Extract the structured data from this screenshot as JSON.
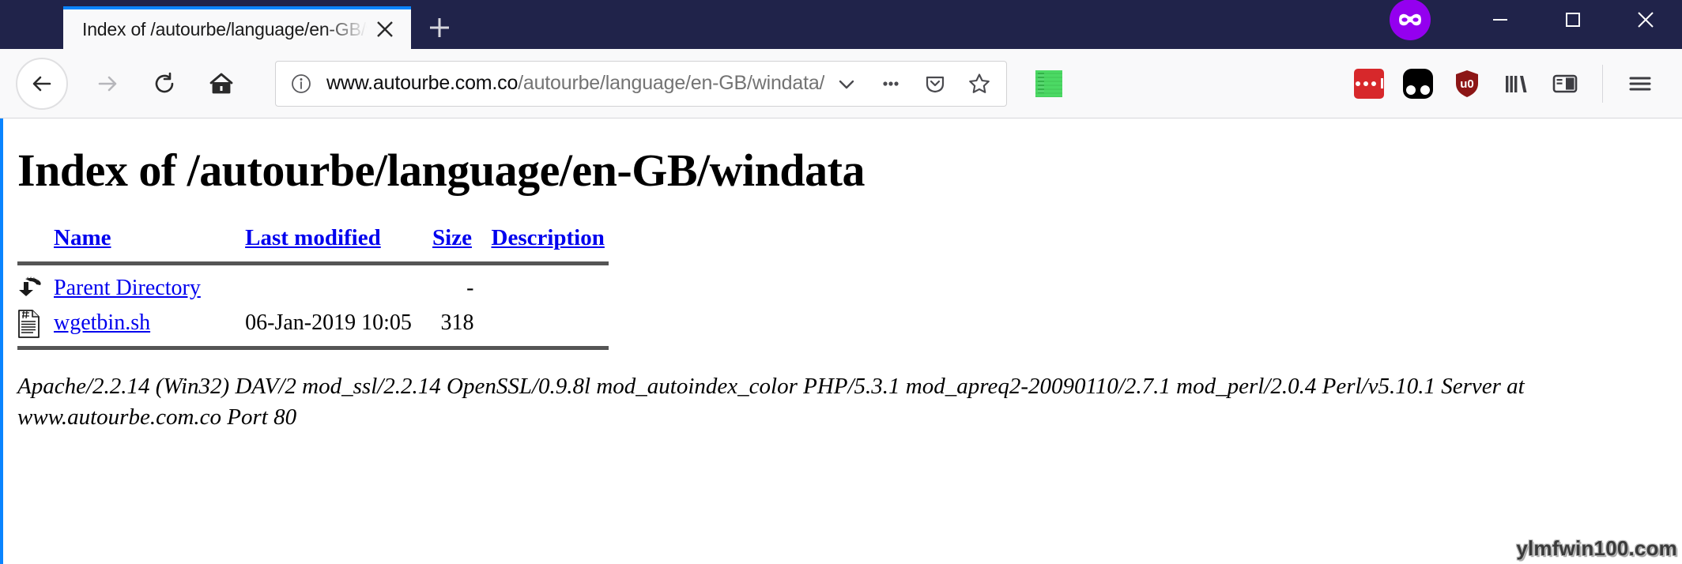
{
  "window": {
    "tab": {
      "title": "Index of /autourbe/language/en-GB/windata",
      "close_label": "Close tab"
    },
    "new_tab_label": "+",
    "controls": {
      "minimize": "—",
      "maximize": "☐",
      "close": "✕"
    },
    "private_badge": "private-browsing-mask"
  },
  "toolbar": {
    "back": "Back",
    "forward": "Forward",
    "reload": "Reload",
    "home": "Home",
    "url": {
      "host": "www.autourbe.com.co",
      "path": "/autourbe/language/en-GB/windata/",
      "full": "www.autourbe.com.co/autourbe/language/en-GB/windata/"
    },
    "url_actions": [
      "chevron-down-icon",
      "page-actions-icon",
      "pocket-icon",
      "bookmark-star-icon"
    ],
    "extensions": [
      "green-grid-icon",
      "lastpass-icon",
      "dark-reader-icon",
      "ublock-origin-icon",
      "library-icon",
      "sidebar-icon"
    ],
    "menu": "Open application menu"
  },
  "page": {
    "heading": "Index of /autourbe/language/en-GB/windata",
    "table": {
      "headers": [
        "Name",
        "Last modified",
        "Size",
        "Description"
      ],
      "rows": [
        {
          "icon": "parent-directory-icon",
          "name": "Parent Directory",
          "modified": "",
          "size": "-",
          "description": ""
        },
        {
          "icon": "script-file-icon",
          "name": "wgetbin.sh",
          "modified": "06-Jan-2019 10:05",
          "size": "318",
          "description": ""
        }
      ]
    },
    "footer": "Apache/2.2.14 (Win32) DAV/2 mod_ssl/2.2.14 OpenSSL/0.9.8l mod_autoindex_color PHP/5.3.1 mod_apreq2-20090110/2.7.1 mod_perl/2.0.4 Perl/v5.10.1 Server at www.autourbe.com.co Port 80"
  },
  "watermark": "ylmfwin100.com",
  "colors": {
    "titlebar": "#20234a",
    "tab_accent": "#0a84ff",
    "link": "#0000ee",
    "private": "#9400ef"
  }
}
